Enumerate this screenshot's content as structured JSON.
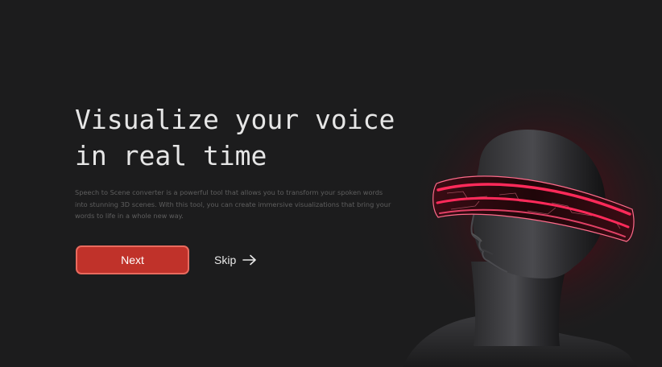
{
  "hero": {
    "headline_line1": "Visualize your voice",
    "headline_line2": "in real time",
    "description": "Speech to Scene converter is a powerful tool that allows you to transform your spoken words into stunning 3D scenes. With this tool, you can create immersive visualizations that bring your words to life in a whole new way."
  },
  "actions": {
    "next_label": "Next",
    "skip_label": "Skip"
  },
  "icons": {
    "skip": "arrow-right-icon",
    "figure": "vr-headset-figure"
  },
  "colors": {
    "background": "#1c1c1d",
    "accent": "#c0322a",
    "accent_border": "#e86a5e",
    "visor_glow": "#ff2a5a"
  }
}
